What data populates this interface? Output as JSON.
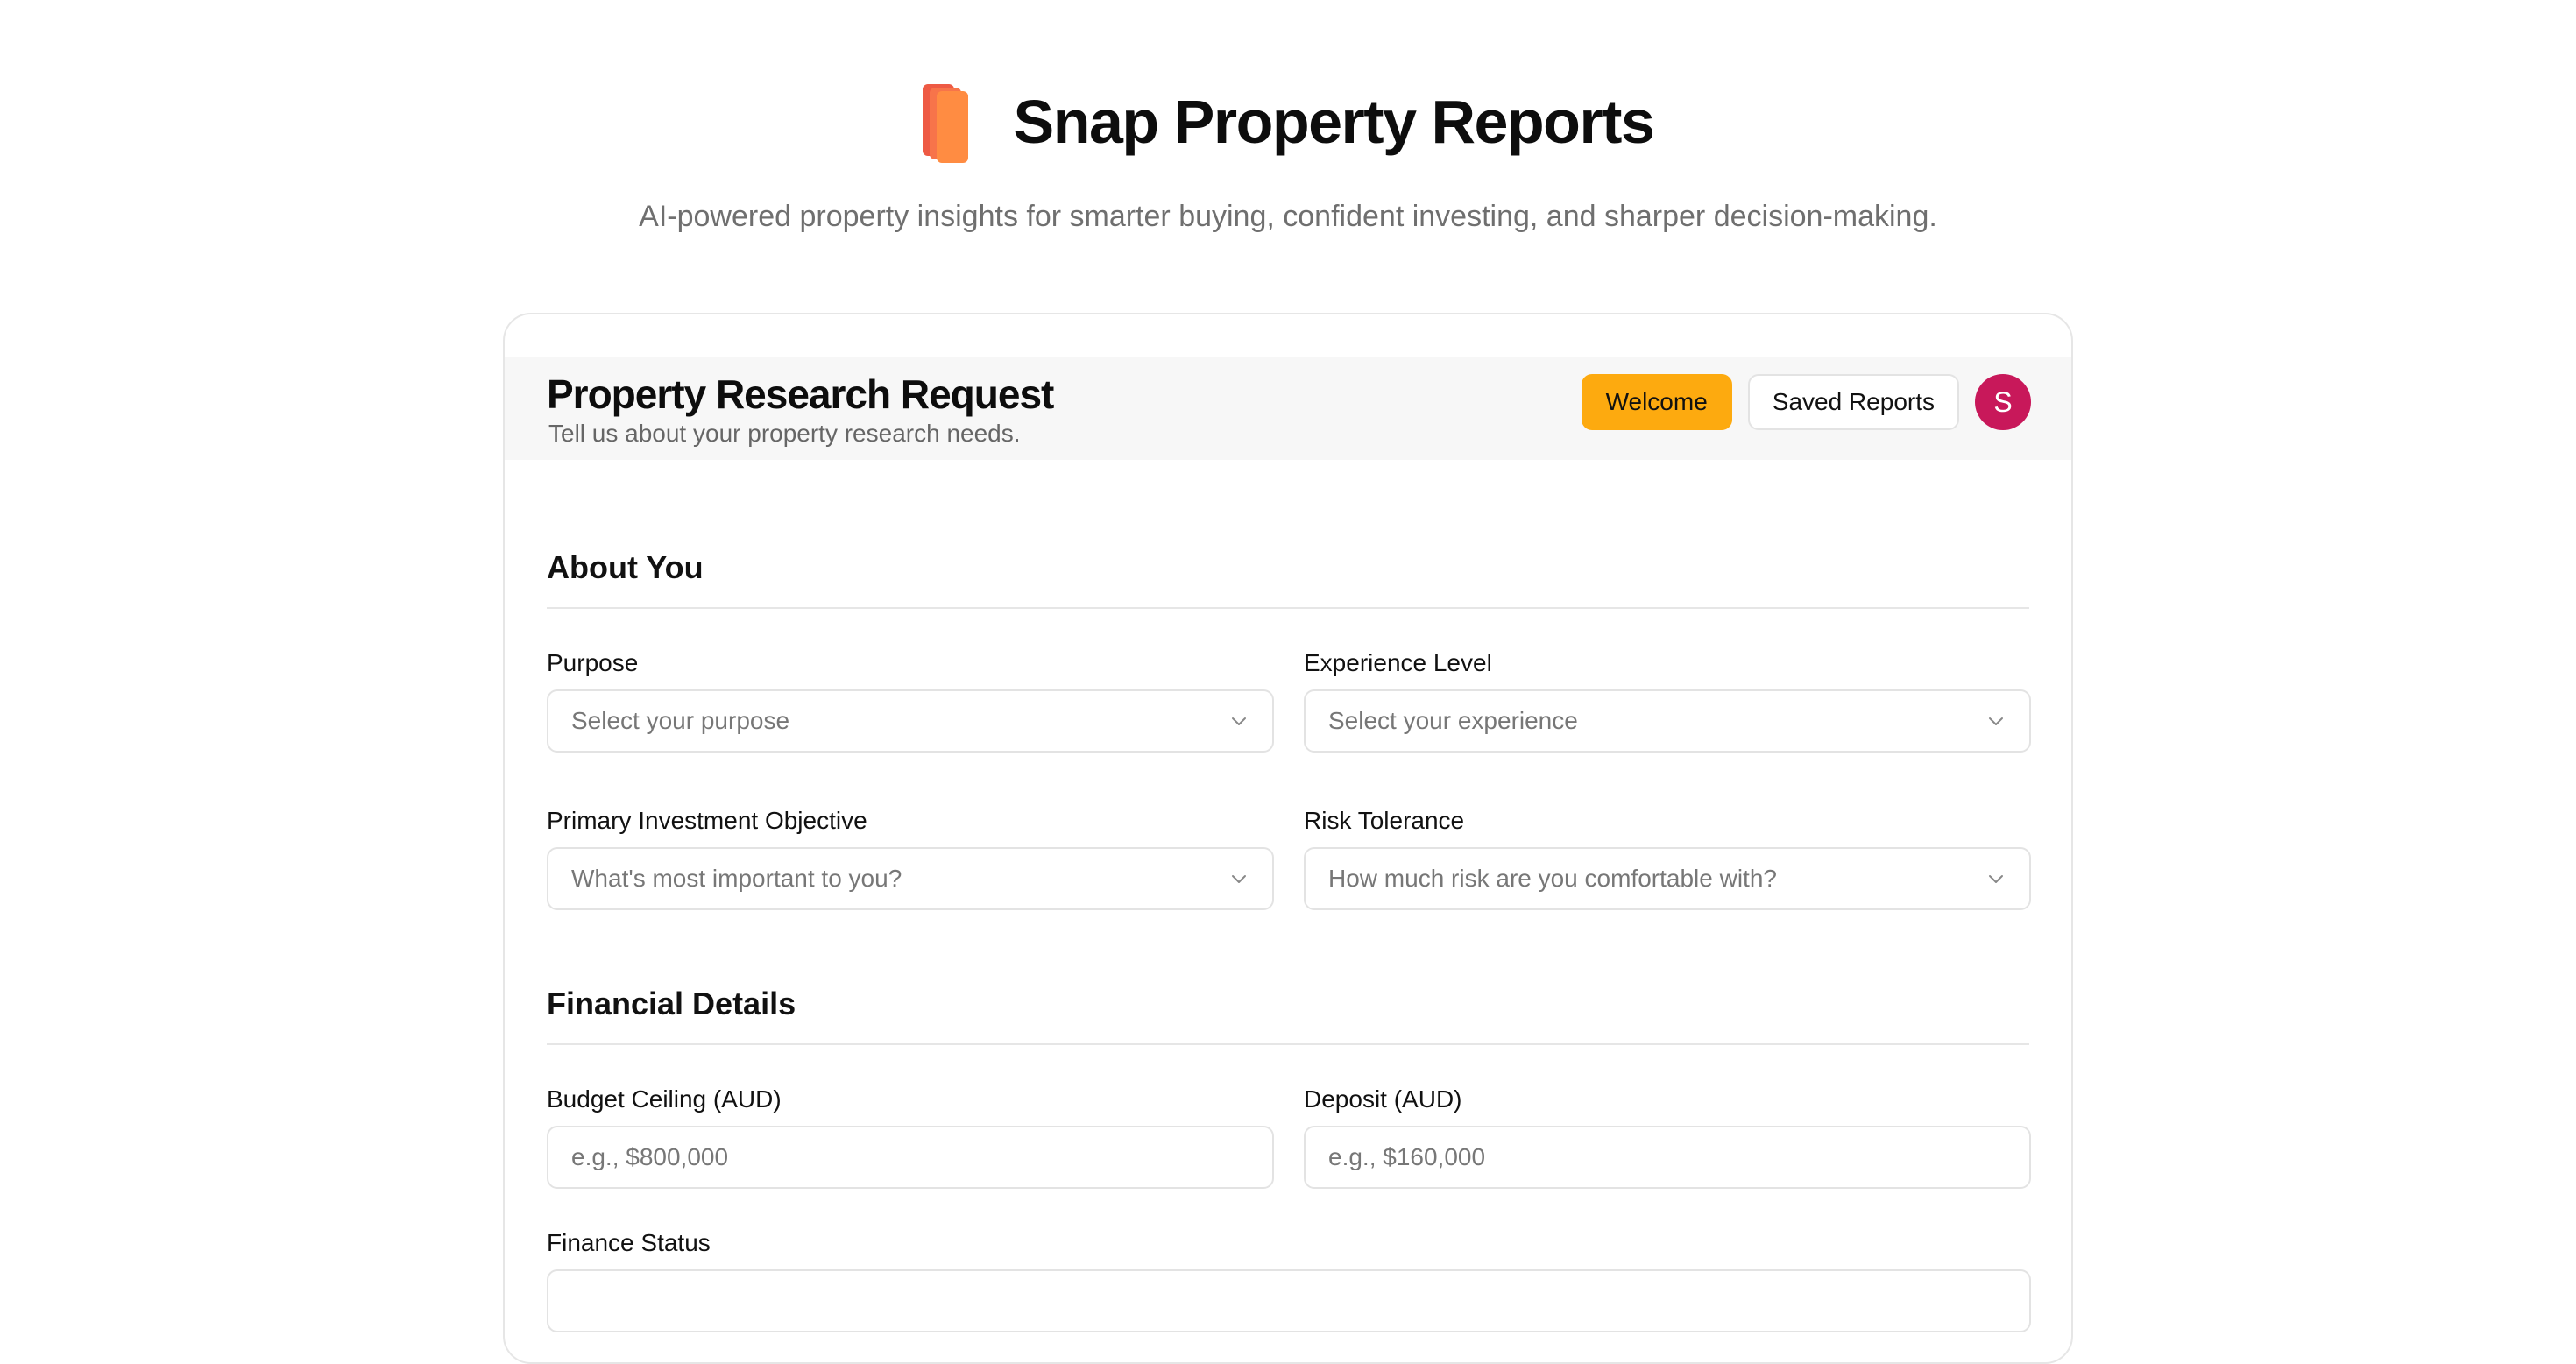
{
  "app": {
    "title": "Snap Property Reports",
    "tagline": "AI-powered property insights for smarter buying, confident investing, and sharper decision-making.",
    "logo_icon": "stacked-cards-icon"
  },
  "card": {
    "title": "Property Research Request",
    "subtitle": "Tell us about your property research needs.",
    "welcome_label": "Welcome",
    "saved_reports_label": "Saved Reports",
    "avatar_initial": "S"
  },
  "sections": {
    "about": {
      "title": "About You",
      "purpose": {
        "label": "Purpose",
        "placeholder": "Select your purpose"
      },
      "experience": {
        "label": "Experience Level",
        "placeholder": "Select your experience"
      },
      "objective": {
        "label": "Primary Investment Objective",
        "placeholder": "What's most important to you?"
      },
      "risk": {
        "label": "Risk Tolerance",
        "placeholder": "How much risk are you comfortable with?"
      }
    },
    "financial": {
      "title": "Financial Details",
      "budget": {
        "label": "Budget Ceiling (AUD)",
        "placeholder": "e.g., $800,000"
      },
      "deposit": {
        "label": "Deposit (AUD)",
        "placeholder": "e.g., $160,000"
      },
      "finance_status": {
        "label": "Finance Status"
      }
    }
  },
  "colors": {
    "accent": "#fdaa0f",
    "avatar": "#c8185a",
    "logo": [
      "#ee5a44",
      "#f7744a",
      "#ff8c42"
    ]
  }
}
